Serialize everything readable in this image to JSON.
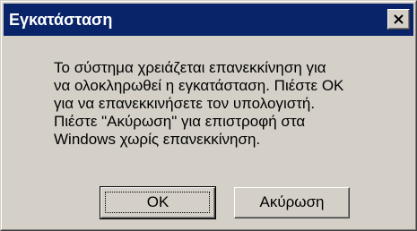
{
  "window": {
    "title": "Εγκατάσταση",
    "close_icon": "close-x-icon"
  },
  "message": {
    "lines": [
      "Το σύστημα χρειάζεται επανεκκίνηση για",
      "να ολοκληρωθεί η εγκατάσταση. Πιέστε OK",
      "για να επανεκκινήσετε τον υπολογιστή.",
      "Πιέστε \"Ακύρωση\" για επιστροφή στα",
      "Windows χωρίς επανεκκίνηση."
    ]
  },
  "buttons": {
    "ok_label": "OK",
    "cancel_label": "Ακύρωση"
  },
  "colors": {
    "titlebar": "#0a246a",
    "dialog_face": "#d4d0c8",
    "title_text": "#ffffff"
  }
}
